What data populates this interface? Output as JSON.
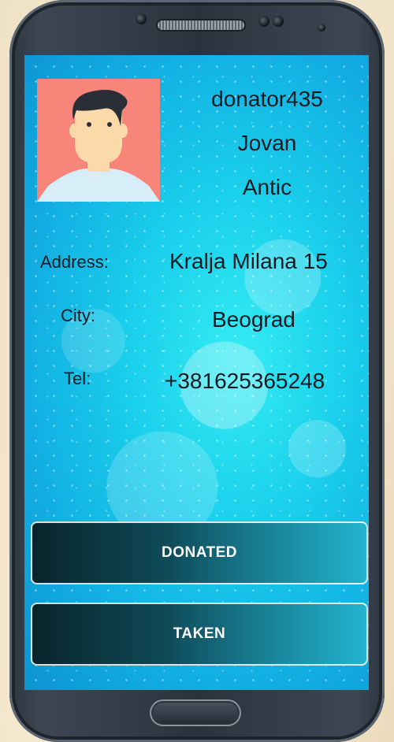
{
  "profile": {
    "username": "donator435",
    "first_name": "Jovan",
    "last_name": "Antic"
  },
  "details": {
    "address_label": "Address:",
    "address_value": "Kralja Milana 15",
    "city_label": "City:",
    "city_value": "Beograd",
    "tel_label": "Tel:",
    "tel_value": "+381625365248"
  },
  "actions": {
    "donated_label": "DONATED",
    "taken_label": "TAKEN"
  },
  "colors": {
    "avatar_background": "#f7857a",
    "screen_accent": "#1ad0ec"
  }
}
